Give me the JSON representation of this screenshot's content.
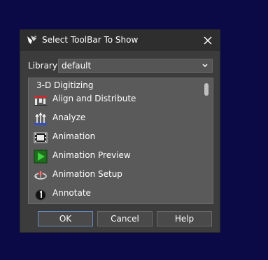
{
  "dialog": {
    "title": "Select ToolBar To Show",
    "close_icon": "close-icon",
    "app_icon": "application-logo-icon"
  },
  "library": {
    "label": "Library",
    "selected": "default"
  },
  "toolbar_list": {
    "header": "3-D Digitizing",
    "items": [
      {
        "label": "Align and Distribute",
        "icon": "align-distribute-icon"
      },
      {
        "label": "Analyze",
        "icon": "analyze-icon"
      },
      {
        "label": "Animation",
        "icon": "film-icon"
      },
      {
        "label": "Animation Preview",
        "icon": "play-icon"
      },
      {
        "label": "Animation Setup",
        "icon": "animation-setup-icon"
      },
      {
        "label": "Annotate",
        "icon": "annotate-icon"
      }
    ]
  },
  "buttons": {
    "ok": "OK",
    "cancel": "Cancel",
    "help": "Help"
  },
  "colors": {
    "desktop_background": "#0b0a47",
    "dialog_background": "#3c3c3c",
    "titlebar": "#2e2e2e",
    "list_background": "#5a5a5a",
    "ok_border_accent": "#6a8ac0"
  }
}
